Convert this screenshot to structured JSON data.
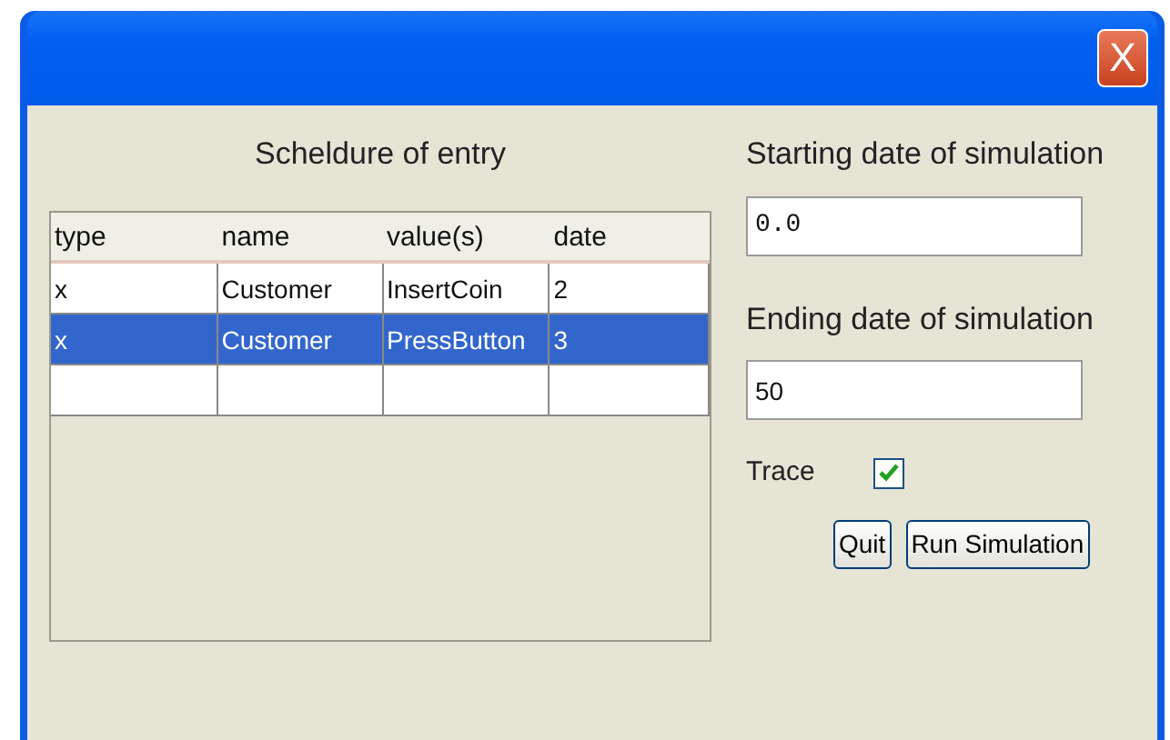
{
  "window": {
    "close": "X"
  },
  "schedule": {
    "title": "Scheldure of entry",
    "columns": [
      "type",
      "name",
      "value(s)",
      "date"
    ],
    "rows": [
      {
        "cells": [
          "x",
          "Customer",
          "InsertCoin",
          "2"
        ],
        "selected": false
      },
      {
        "cells": [
          "x",
          "Customer",
          "PressButton",
          "3"
        ],
        "selected": true
      }
    ]
  },
  "start": {
    "label": "Starting date of simulation",
    "value": "0.0"
  },
  "end": {
    "label": "Ending date of simulation",
    "value": "50"
  },
  "trace": {
    "label": "Trace",
    "checked": true
  },
  "buttons": [
    {
      "label": "Quit"
    },
    {
      "label": "Run Simulation"
    }
  ]
}
